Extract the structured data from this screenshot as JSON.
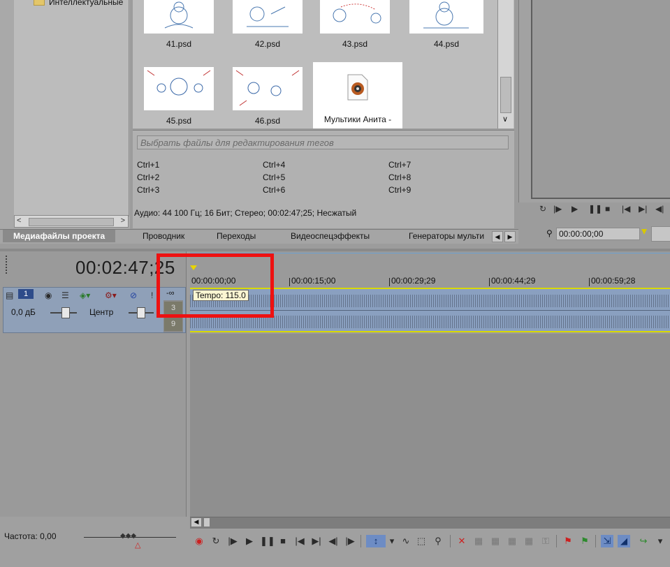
{
  "explorer": {
    "tree_item": "Интеллектуальные"
  },
  "media": {
    "thumbnails": [
      {
        "label": "41.psd"
      },
      {
        "label": "42.psd"
      },
      {
        "label": "43.psd"
      },
      {
        "label": "44.psd"
      },
      {
        "label": "45.psd"
      },
      {
        "label": "46.psd"
      },
      {
        "label": "Мультики Анита -"
      }
    ]
  },
  "tags": {
    "placeholder": "Выбрать файлы для редактирования тегов",
    "shortcuts": [
      "Ctrl+1",
      "Ctrl+2",
      "Ctrl+3",
      "Ctrl+4",
      "Ctrl+5",
      "Ctrl+6",
      "Ctrl+7",
      "Ctrl+8",
      "Ctrl+9"
    ]
  },
  "info": "Аудио: 44 100 Гц; 16 Бит; Стерео; 00:02:47;25; Несжатый",
  "tabs": [
    "Медиафайлы проекта",
    "Проводник",
    "Переходы",
    "Видеоспецэффекты",
    "Генераторы мульти"
  ],
  "preview": {
    "time": "00:00:00;00"
  },
  "timeline": {
    "current_time": "00:02:47;25",
    "ruler": [
      "00:00:00;00",
      "00:00:15;00",
      "00:00:29;29",
      "00:00:44;29",
      "00:00:59;28"
    ],
    "tempo": "Tempo: 115.0"
  },
  "track": {
    "number": "1",
    "volume": "0,0 дБ",
    "pan": "Центр",
    "meter_top": "-∞",
    "meter_a": "3",
    "meter_b": "9"
  },
  "bottom": {
    "frequency": "Частота: 0,00"
  },
  "colors": {
    "highlight": "#ee1111",
    "clip": "#8aa0c0",
    "clip_border": "#d9d900",
    "selected_tool": "#6d8cc4"
  }
}
